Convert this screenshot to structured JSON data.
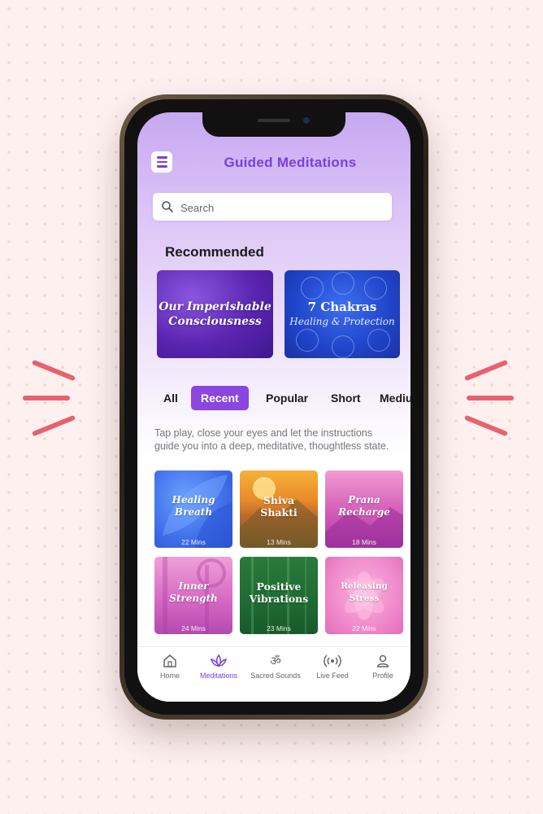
{
  "app": {
    "title": "Guided Meditations"
  },
  "search": {
    "placeholder": "Search"
  },
  "recommended": {
    "heading": "Recommended",
    "cards": [
      {
        "title_line1": "Our Imperishable",
        "title_line2": "Consciousness"
      },
      {
        "title": "7 Chakras",
        "subtitle": "Healing & Protection"
      }
    ]
  },
  "filters": [
    {
      "label": "All"
    },
    {
      "label": "Recent",
      "active": true
    },
    {
      "label": "Popular"
    },
    {
      "label": "Short"
    },
    {
      "label": "Mediu"
    }
  ],
  "description": "Tap play, close your eyes and let the instructions guide you into a deep, meditative, thoughtless state.",
  "meditations": [
    {
      "title": "Healing Breath",
      "duration": "22 Mins"
    },
    {
      "title_line1": "Shiva",
      "title_line2": "Shakti",
      "duration": "13 Mins"
    },
    {
      "title_line1": "Prana",
      "title_line2": "Recharge",
      "duration": "18 Mins"
    },
    {
      "title_line1": "Inner",
      "title_line2": "Strength",
      "duration": "24 Mins"
    },
    {
      "title_line1": "Positive",
      "title_line2": "Vibrations",
      "duration": "23 Mins"
    },
    {
      "title": "Releasing Stress",
      "duration": "22 Mins"
    }
  ],
  "tabs": [
    {
      "label": "Home",
      "icon": "home-icon"
    },
    {
      "label": "Meditations",
      "icon": "lotus-icon",
      "active": true
    },
    {
      "label": "Sacred Sounds",
      "icon": "om-icon",
      "glyph": "ॐ"
    },
    {
      "label": "Live Feed",
      "icon": "broadcast-icon"
    },
    {
      "label": "Profile",
      "icon": "user-icon"
    }
  ],
  "colors": {
    "accent": "#7b3fde",
    "chip_active": "#8b45e0",
    "decor": "#e8616f"
  }
}
